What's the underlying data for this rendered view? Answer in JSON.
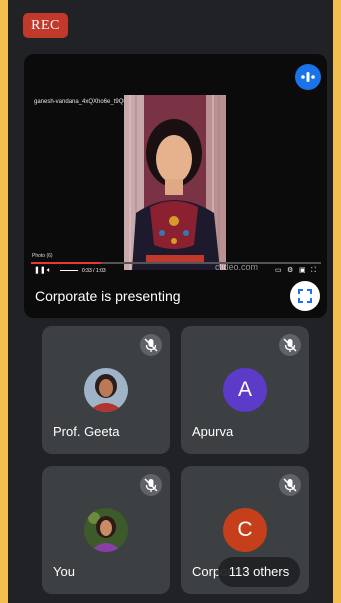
{
  "recording_badge": {
    "label": "REC",
    "color": "#c0392b"
  },
  "presentation": {
    "label": "Corporate is presenting",
    "video_filename": "ganesh-vandana_4xQXho6e_t9Qu.mp4",
    "quality_label": "Photo (6)",
    "time_label": "0:33 / 1:03",
    "watermark": "clideo.com",
    "progress_fraction": 0.24,
    "more_options_icon": "more-vert-icon",
    "fullscreen_icon": "fullscreen-icon"
  },
  "participants": [
    {
      "name": "Prof. Geeta",
      "avatar": "photo",
      "muted": true
    },
    {
      "name": "Apurva",
      "avatar_letter": "A",
      "avatar_color": "#5c3bc8",
      "muted": true
    },
    {
      "name": "You",
      "avatar": "photo",
      "muted": true
    },
    {
      "name": "Corporate",
      "avatar_letter": "C",
      "avatar_color": "#c5401a",
      "muted": true
    }
  ],
  "others_pill": {
    "label": "113 others"
  },
  "colors": {
    "frame": "#f4bd50",
    "background": "#212226",
    "tile": "#3c4043",
    "accent": "#1a73e8"
  }
}
